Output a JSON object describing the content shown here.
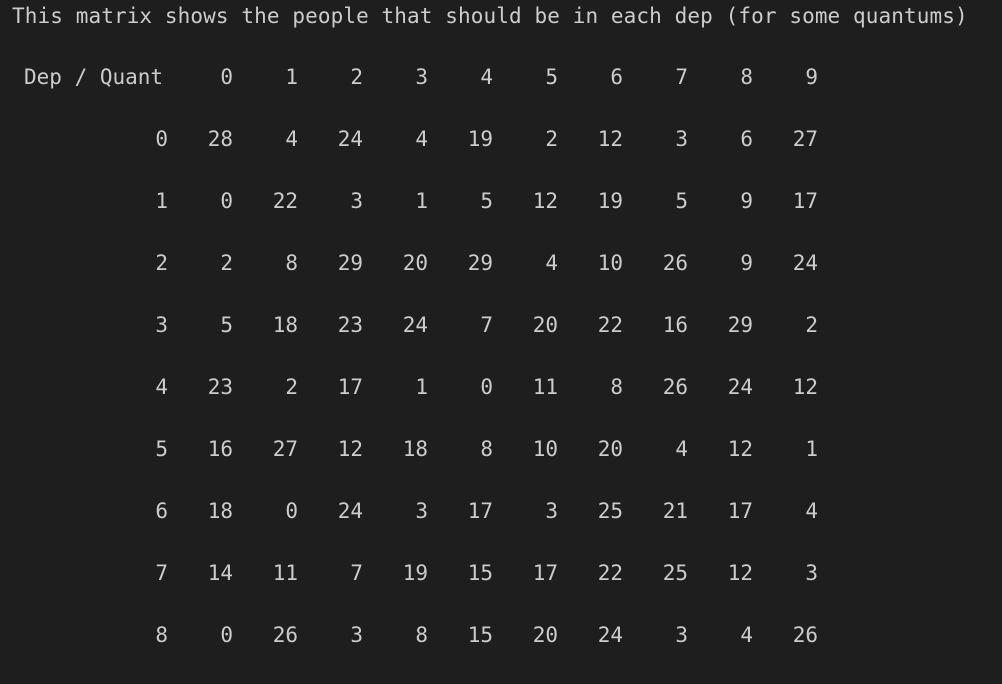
{
  "intro_text": "This matrix shows the people that should be in each dep (for some quantums)",
  "matrix": {
    "corner_label": "Dep / Quant",
    "column_headers": [
      "0",
      "1",
      "2",
      "3",
      "4",
      "5",
      "6",
      "7",
      "8",
      "9"
    ],
    "rows": [
      {
        "label": "0",
        "values": [
          "28",
          "4",
          "24",
          "4",
          "19",
          "2",
          "12",
          "3",
          "6",
          "27"
        ]
      },
      {
        "label": "1",
        "values": [
          "0",
          "22",
          "3",
          "1",
          "5",
          "12",
          "19",
          "5",
          "9",
          "17"
        ]
      },
      {
        "label": "2",
        "values": [
          "2",
          "8",
          "29",
          "20",
          "29",
          "4",
          "10",
          "26",
          "9",
          "24"
        ]
      },
      {
        "label": "3",
        "values": [
          "5",
          "18",
          "23",
          "24",
          "7",
          "20",
          "22",
          "16",
          "29",
          "2"
        ]
      },
      {
        "label": "4",
        "values": [
          "23",
          "2",
          "17",
          "1",
          "0",
          "11",
          "8",
          "26",
          "24",
          "12"
        ]
      },
      {
        "label": "5",
        "values": [
          "16",
          "27",
          "12",
          "18",
          "8",
          "10",
          "20",
          "4",
          "12",
          "1"
        ]
      },
      {
        "label": "6",
        "values": [
          "18",
          "0",
          "24",
          "3",
          "17",
          "3",
          "25",
          "21",
          "17",
          "4"
        ]
      },
      {
        "label": "7",
        "values": [
          "14",
          "11",
          "7",
          "19",
          "15",
          "17",
          "22",
          "25",
          "12",
          "3"
        ]
      },
      {
        "label": "8",
        "values": [
          "0",
          "26",
          "3",
          "8",
          "15",
          "20",
          "24",
          "3",
          "4",
          "26"
        ]
      }
    ]
  }
}
